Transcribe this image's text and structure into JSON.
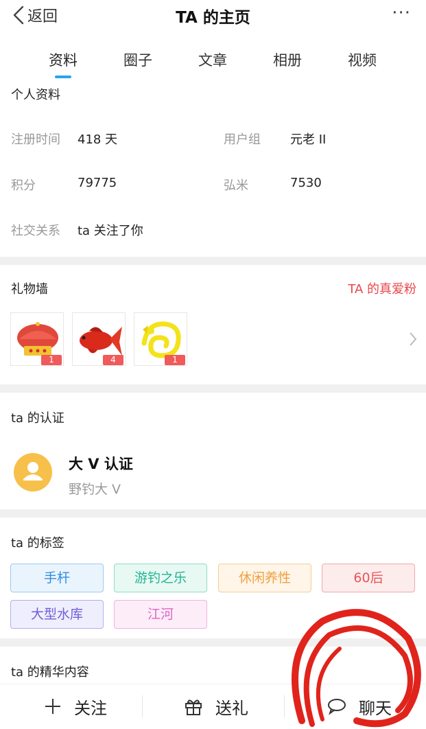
{
  "header": {
    "back_label": "返回",
    "title": "TA 的主页",
    "more_label": "···"
  },
  "tabs": [
    {
      "label": "资料",
      "active": true
    },
    {
      "label": "圈子"
    },
    {
      "label": "文章"
    },
    {
      "label": "相册"
    },
    {
      "label": "视频"
    }
  ],
  "profile": {
    "section_title": "个人资料",
    "rows": [
      {
        "label": "注册时间",
        "value": "418 天",
        "label2": "用户组",
        "value2": "元老 II"
      },
      {
        "label": "积分",
        "value": "79775",
        "label2": "弘米",
        "value2": "7530"
      },
      {
        "label": "社交关系",
        "value": "ta 关注了你"
      }
    ]
  },
  "gifts": {
    "section_title": "礼物墙",
    "fans_link": "TA 的真爱粉",
    "items": [
      {
        "icon": "crown-icon",
        "count": "1"
      },
      {
        "icon": "red-fish-icon",
        "count": "4"
      },
      {
        "icon": "golden-dragon-icon",
        "count": "1"
      }
    ]
  },
  "certification": {
    "section_title": "ta 的认证",
    "name": "大 V 认证",
    "subtitle": "野钓大 V"
  },
  "tags": {
    "section_title": "ta 的标签",
    "items": [
      {
        "label": "手杆",
        "color": "#2f8de0",
        "bg": "#eaf4fd",
        "border": "#9cc9f0"
      },
      {
        "label": "游钓之乐",
        "color": "#1fb58f",
        "bg": "#e8f8f3",
        "border": "#8fdcc5"
      },
      {
        "label": "休闲养性",
        "color": "#f0a040",
        "bg": "#fff5e8",
        "border": "#f5cd98"
      },
      {
        "label": "60后",
        "color": "#e8565a",
        "bg": "#fdecec",
        "border": "#f2a8aa"
      },
      {
        "label": "大型水库",
        "color": "#6a60d8",
        "bg": "#efeefc",
        "border": "#b4aeee"
      },
      {
        "label": "江河",
        "color": "#e064c4",
        "bg": "#fcedf8",
        "border": "#efb3e2"
      }
    ]
  },
  "highlights": {
    "section_title": "ta 的精华内容"
  },
  "bottom_bar": {
    "follow_label": "关注",
    "gift_label": "送礼",
    "chat_label": "聊天"
  },
  "colors": {
    "accent": "#2aa4e6",
    "fans_link": "#e8474a",
    "annotation_circle": "#e0241b"
  }
}
